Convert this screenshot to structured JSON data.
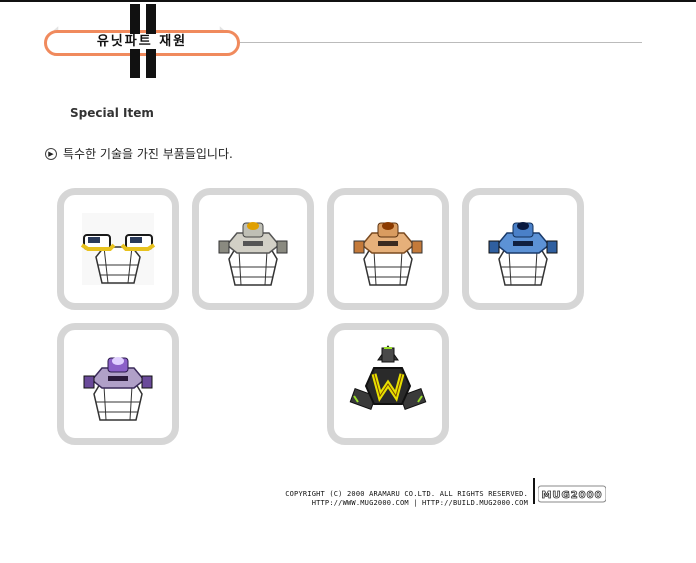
{
  "header": {
    "title": "유닛파트 재원"
  },
  "section": {
    "label": "Special Item"
  },
  "description": {
    "text": "특수한 기술을 가진 부품들입니다."
  },
  "items": [
    {
      "name": "yellow twin-pod part",
      "accent": "#e8c21e"
    },
    {
      "name": "gray pod part",
      "accent": "#e0a000"
    },
    {
      "name": "orange pod part",
      "accent": "#e39a4d"
    },
    {
      "name": "blue pod part",
      "accent": "#3a7fd0"
    },
    {
      "name": "purple pod part",
      "accent": "#8b60c8"
    },
    {
      "name": "W emblem part",
      "accent": "#e8e000"
    }
  ],
  "footer": {
    "line1": "COPYRIGHT (C) 2000 ARAMARU CO.LTD. ALL RIGHTS RESERVED.",
    "line2": "HTTP://WWW.MUG2000.COM | HTTP://BUILD.MUG2000.COM",
    "logo": "MUG2000"
  },
  "colors": {
    "banner_border": "#f08a5d",
    "tile_border": "#d6d6d6"
  }
}
